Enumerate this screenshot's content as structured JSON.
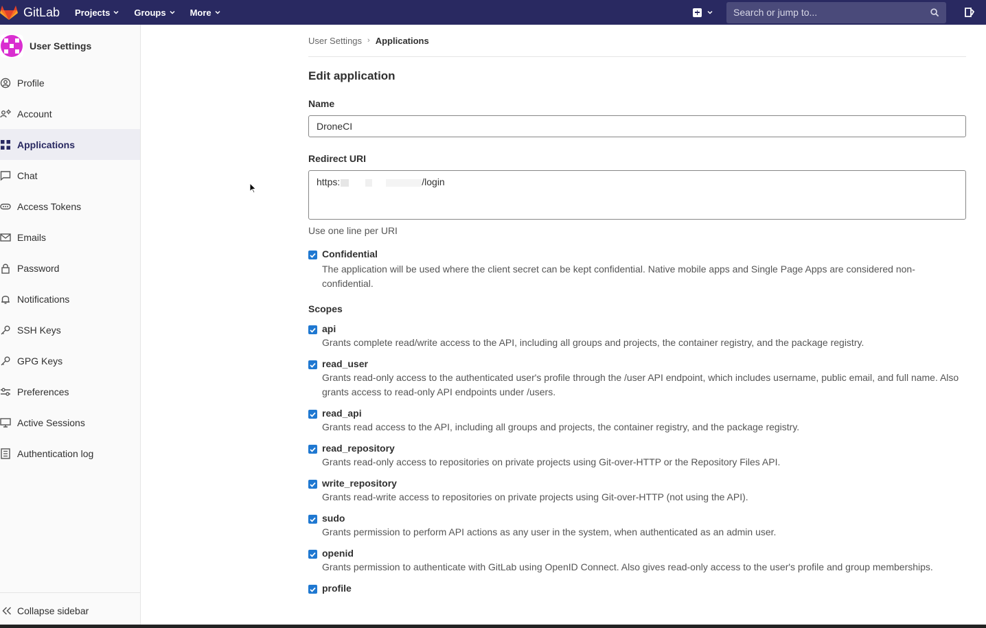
{
  "navbar": {
    "brand": "GitLab",
    "menus": [
      "Projects",
      "Groups",
      "More"
    ],
    "search_placeholder": "Search or jump to..."
  },
  "sidebar": {
    "title": "User Settings",
    "items": [
      {
        "label": "Profile",
        "icon": "profile-icon"
      },
      {
        "label": "Account",
        "icon": "account-icon"
      },
      {
        "label": "Applications",
        "icon": "applications-icon",
        "active": true
      },
      {
        "label": "Chat",
        "icon": "chat-icon"
      },
      {
        "label": "Access Tokens",
        "icon": "token-icon"
      },
      {
        "label": "Emails",
        "icon": "mail-icon"
      },
      {
        "label": "Password",
        "icon": "lock-icon"
      },
      {
        "label": "Notifications",
        "icon": "bell-icon"
      },
      {
        "label": "SSH Keys",
        "icon": "key-icon"
      },
      {
        "label": "GPG Keys",
        "icon": "key-icon"
      },
      {
        "label": "Preferences",
        "icon": "preferences-icon"
      },
      {
        "label": "Active Sessions",
        "icon": "monitor-icon"
      },
      {
        "label": "Authentication log",
        "icon": "log-icon"
      }
    ],
    "collapse_label": "Collapse sidebar"
  },
  "breadcrumb": {
    "parent": "User Settings",
    "current": "Applications"
  },
  "form": {
    "title": "Edit application",
    "name_label": "Name",
    "name_value": "DroneCI",
    "redirect_label": "Redirect URI",
    "redirect_prefix": "https:",
    "redirect_suffix": "/login",
    "redirect_help": "Use one line per URI",
    "confidential_label": "Confidential",
    "confidential_desc": "The application will be used where the client secret can be kept confidential. Native mobile apps and Single Page Apps are considered non-confidential.",
    "scopes_title": "Scopes",
    "scopes": [
      {
        "name": "api",
        "desc": "Grants complete read/write access to the API, including all groups and projects, the container registry, and the package registry."
      },
      {
        "name": "read_user",
        "desc": "Grants read-only access to the authenticated user's profile through the /user API endpoint, which includes username, public email, and full name. Also grants access to read-only API endpoints under /users."
      },
      {
        "name": "read_api",
        "desc": "Grants read access to the API, including all groups and projects, the container registry, and the package registry."
      },
      {
        "name": "read_repository",
        "desc": "Grants read-only access to repositories on private projects using Git-over-HTTP or the Repository Files API."
      },
      {
        "name": "write_repository",
        "desc": "Grants read-write access to repositories on private projects using Git-over-HTTP (not using the API)."
      },
      {
        "name": "sudo",
        "desc": "Grants permission to perform API actions as any user in the system, when authenticated as an admin user."
      },
      {
        "name": "openid",
        "desc": "Grants permission to authenticate with GitLab using OpenID Connect. Also gives read-only access to the user's profile and group memberships."
      },
      {
        "name": "profile",
        "desc": ""
      }
    ]
  }
}
